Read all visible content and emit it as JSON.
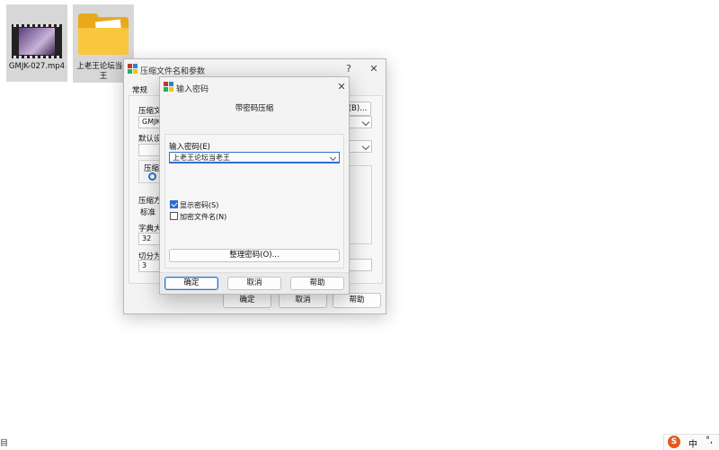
{
  "desktop": {
    "icons": [
      {
        "label": "GMJK-027.mp4"
      },
      {
        "label": "上老王论坛当老王"
      }
    ]
  },
  "compress_dialog": {
    "title": "压缩文件名和参数",
    "help_glyph": "?",
    "close_glyph": "✕",
    "tab_general": "常规",
    "archive_label_partial": "压缩文",
    "archive_value_partial": "GMJK-",
    "browse_button_partial": "(B)...",
    "default_label_partial": "默认设",
    "format_label_partial": "压缩",
    "method_label_partial": "压缩方",
    "method_value_partial": "标准",
    "dict_label_partial": "字典大",
    "dict_value": "32",
    "split_label_partial": "切分为",
    "split_value": "3",
    "ok": "确定",
    "cancel": "取消",
    "help": "帮助"
  },
  "password_dialog": {
    "title": "输入密码",
    "close_glyph": "✕",
    "heading": "带密码压缩",
    "password_label": "输入密码(E)",
    "password_value": "上老王论坛当老王",
    "show_password": "显示密码(S)",
    "show_password_checked": true,
    "encrypt_names": "加密文件名(N)",
    "encrypt_names_checked": false,
    "organize_button": "整理密码(O)...",
    "ok": "确定",
    "cancel": "取消",
    "help": "帮助"
  },
  "taskbar": {
    "ime_logo": "S",
    "ime_mode": "中",
    "ime_punct": "°,",
    "left_edge_glyph": "目"
  },
  "colors": {
    "accent": "#2c6fd1",
    "folder": "#f8c73e",
    "ime": "#e35a1c"
  }
}
